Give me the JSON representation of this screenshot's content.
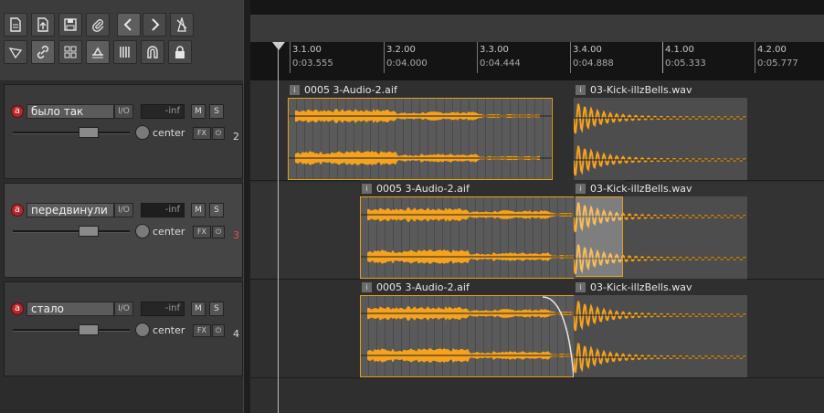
{
  "toolbar": {
    "buttons": [
      {
        "name": "new-project-icon"
      },
      {
        "name": "open-project-icon"
      },
      {
        "name": "save-project-icon"
      },
      {
        "name": "paperclip-icon"
      },
      {
        "name": "undo-icon"
      },
      {
        "name": "redo-icon"
      },
      {
        "name": "metronome-icon"
      },
      {
        "name": "envelope-icon"
      },
      {
        "name": "link-icon"
      },
      {
        "name": "grid-icon"
      },
      {
        "name": "ripple-edit-icon"
      },
      {
        "name": "snap-lines-icon"
      },
      {
        "name": "magnet-icon"
      },
      {
        "name": "lock-icon"
      }
    ]
  },
  "ruler": {
    "marks": [
      {
        "bar": "3.1.00",
        "time": "0:03.555"
      },
      {
        "bar": "3.2.00",
        "time": "0:04.000"
      },
      {
        "bar": "3.3.00",
        "time": "0:04.444"
      },
      {
        "bar": "3.4.00",
        "time": "0:04.888"
      },
      {
        "bar": "4.1.00",
        "time": "0:05.333"
      },
      {
        "bar": "4.2.00",
        "time": "0:05.777"
      }
    ]
  },
  "tracks": [
    {
      "name": "было так",
      "io": "I/O",
      "meter": "-inf",
      "mute": "M",
      "solo": "S",
      "pan": "center",
      "fx": "FX",
      "number": "2",
      "rec": "a"
    },
    {
      "name": "передвинули",
      "io": "I/O",
      "meter": "-inf",
      "mute": "M",
      "solo": "S",
      "pan": "center",
      "fx": "FX",
      "number": "3",
      "rec": "a"
    },
    {
      "name": "стало",
      "io": "I/O",
      "meter": "-inf",
      "mute": "M",
      "solo": "S",
      "pan": "center",
      "fx": "FX",
      "number": "4",
      "rec": "a"
    }
  ],
  "items": {
    "audio_label": "0005 3-Audio-2.aif",
    "kick_label": "03-Kick-illzBells.wav",
    "info_glyph": "i"
  },
  "colors": {
    "waveform": "#f5a21c",
    "record": "#b8242a",
    "selected_track_number": "#e05050"
  }
}
